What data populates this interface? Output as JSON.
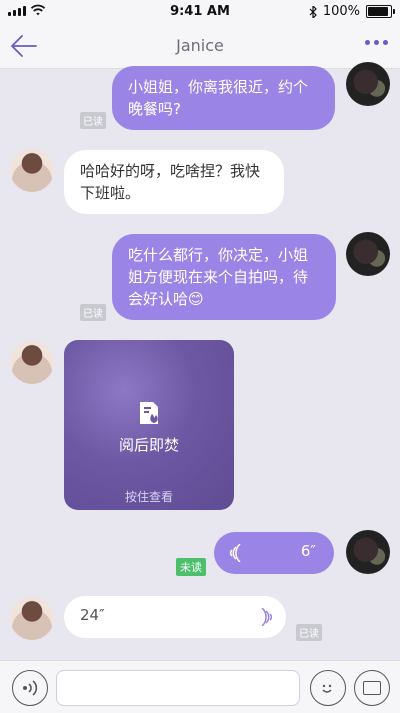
{
  "status": {
    "time": "9:41 AM",
    "battery": "100%",
    "battery_level": 1.0
  },
  "header": {
    "title": "Janice"
  },
  "messages": [
    {
      "id": "m1",
      "text": "小姐姐，你离我很近，约个晚餐吗?",
      "read": "已读"
    },
    {
      "id": "m2",
      "text": "哈哈好的呀，吃啥捏？我快下班啦。"
    },
    {
      "id": "m3",
      "text": "吃什么都行，你决定，小姐姐方便现在来个自拍吗，待会好认哈",
      "emoji": "😊",
      "read": "已读"
    },
    {
      "id": "burn",
      "label": "阅后即焚",
      "hint": "按住查看"
    },
    {
      "id": "v1",
      "duration": "6″",
      "status": "未读"
    },
    {
      "id": "v2",
      "duration": "24″",
      "read": "已读"
    }
  ]
}
